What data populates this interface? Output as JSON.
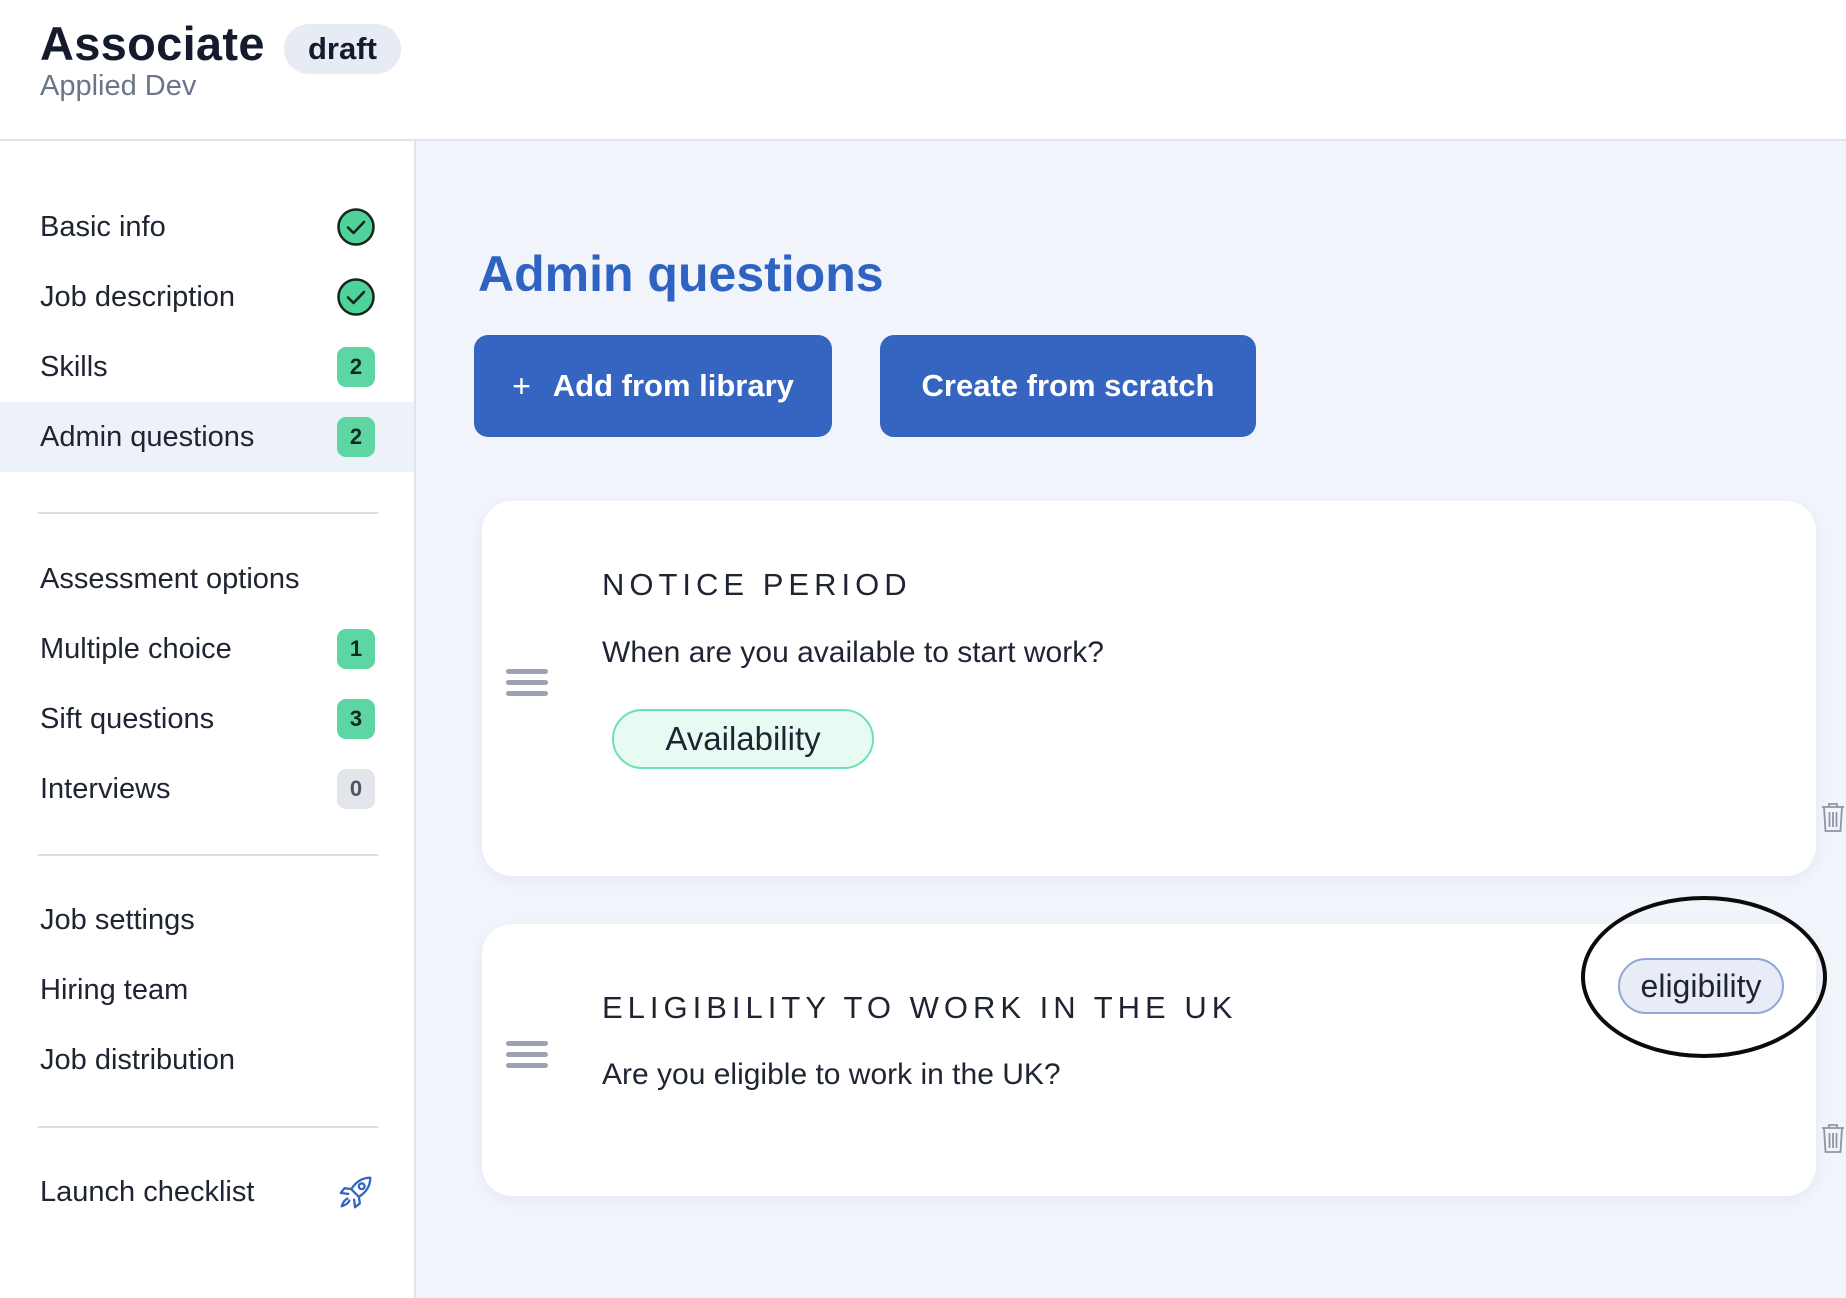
{
  "header": {
    "title": "Associate",
    "status": "draft",
    "org": "Applied Dev"
  },
  "sidebar": {
    "items": [
      {
        "label": "Basic info",
        "status": "complete",
        "icon": "check-circle-icon"
      },
      {
        "label": "Job description",
        "status": "complete",
        "icon": "check-circle-icon"
      },
      {
        "label": "Skills",
        "count": "2"
      },
      {
        "label": "Admin questions",
        "count": "2",
        "active": true
      },
      {
        "label": "Assessment options"
      },
      {
        "label": "Multiple choice",
        "count": "1"
      },
      {
        "label": "Sift questions",
        "count": "3"
      },
      {
        "label": "Interviews",
        "count": "0"
      },
      {
        "label": "Job settings"
      },
      {
        "label": "Hiring team"
      },
      {
        "label": "Job distribution"
      },
      {
        "label": "Launch checklist",
        "icon": "rocket-icon"
      }
    ]
  },
  "main": {
    "title": "Admin questions",
    "add_button": "Add from library",
    "create_button": "Create from scratch",
    "questions": [
      {
        "title": "NOTICE PERIOD",
        "text": "When are you available to start work?",
        "tag": "Availability"
      },
      {
        "title": "ELIGIBILITY TO WORK IN THE UK",
        "text": "Are you eligible to work in the UK?",
        "tag": "eligibility"
      }
    ]
  },
  "colors": {
    "accent": "#3565c0",
    "title_blue": "#2f63c2",
    "badge_green": "#5ed6a3",
    "check_green": "#4fd39a",
    "background": "#f1f4fa"
  }
}
